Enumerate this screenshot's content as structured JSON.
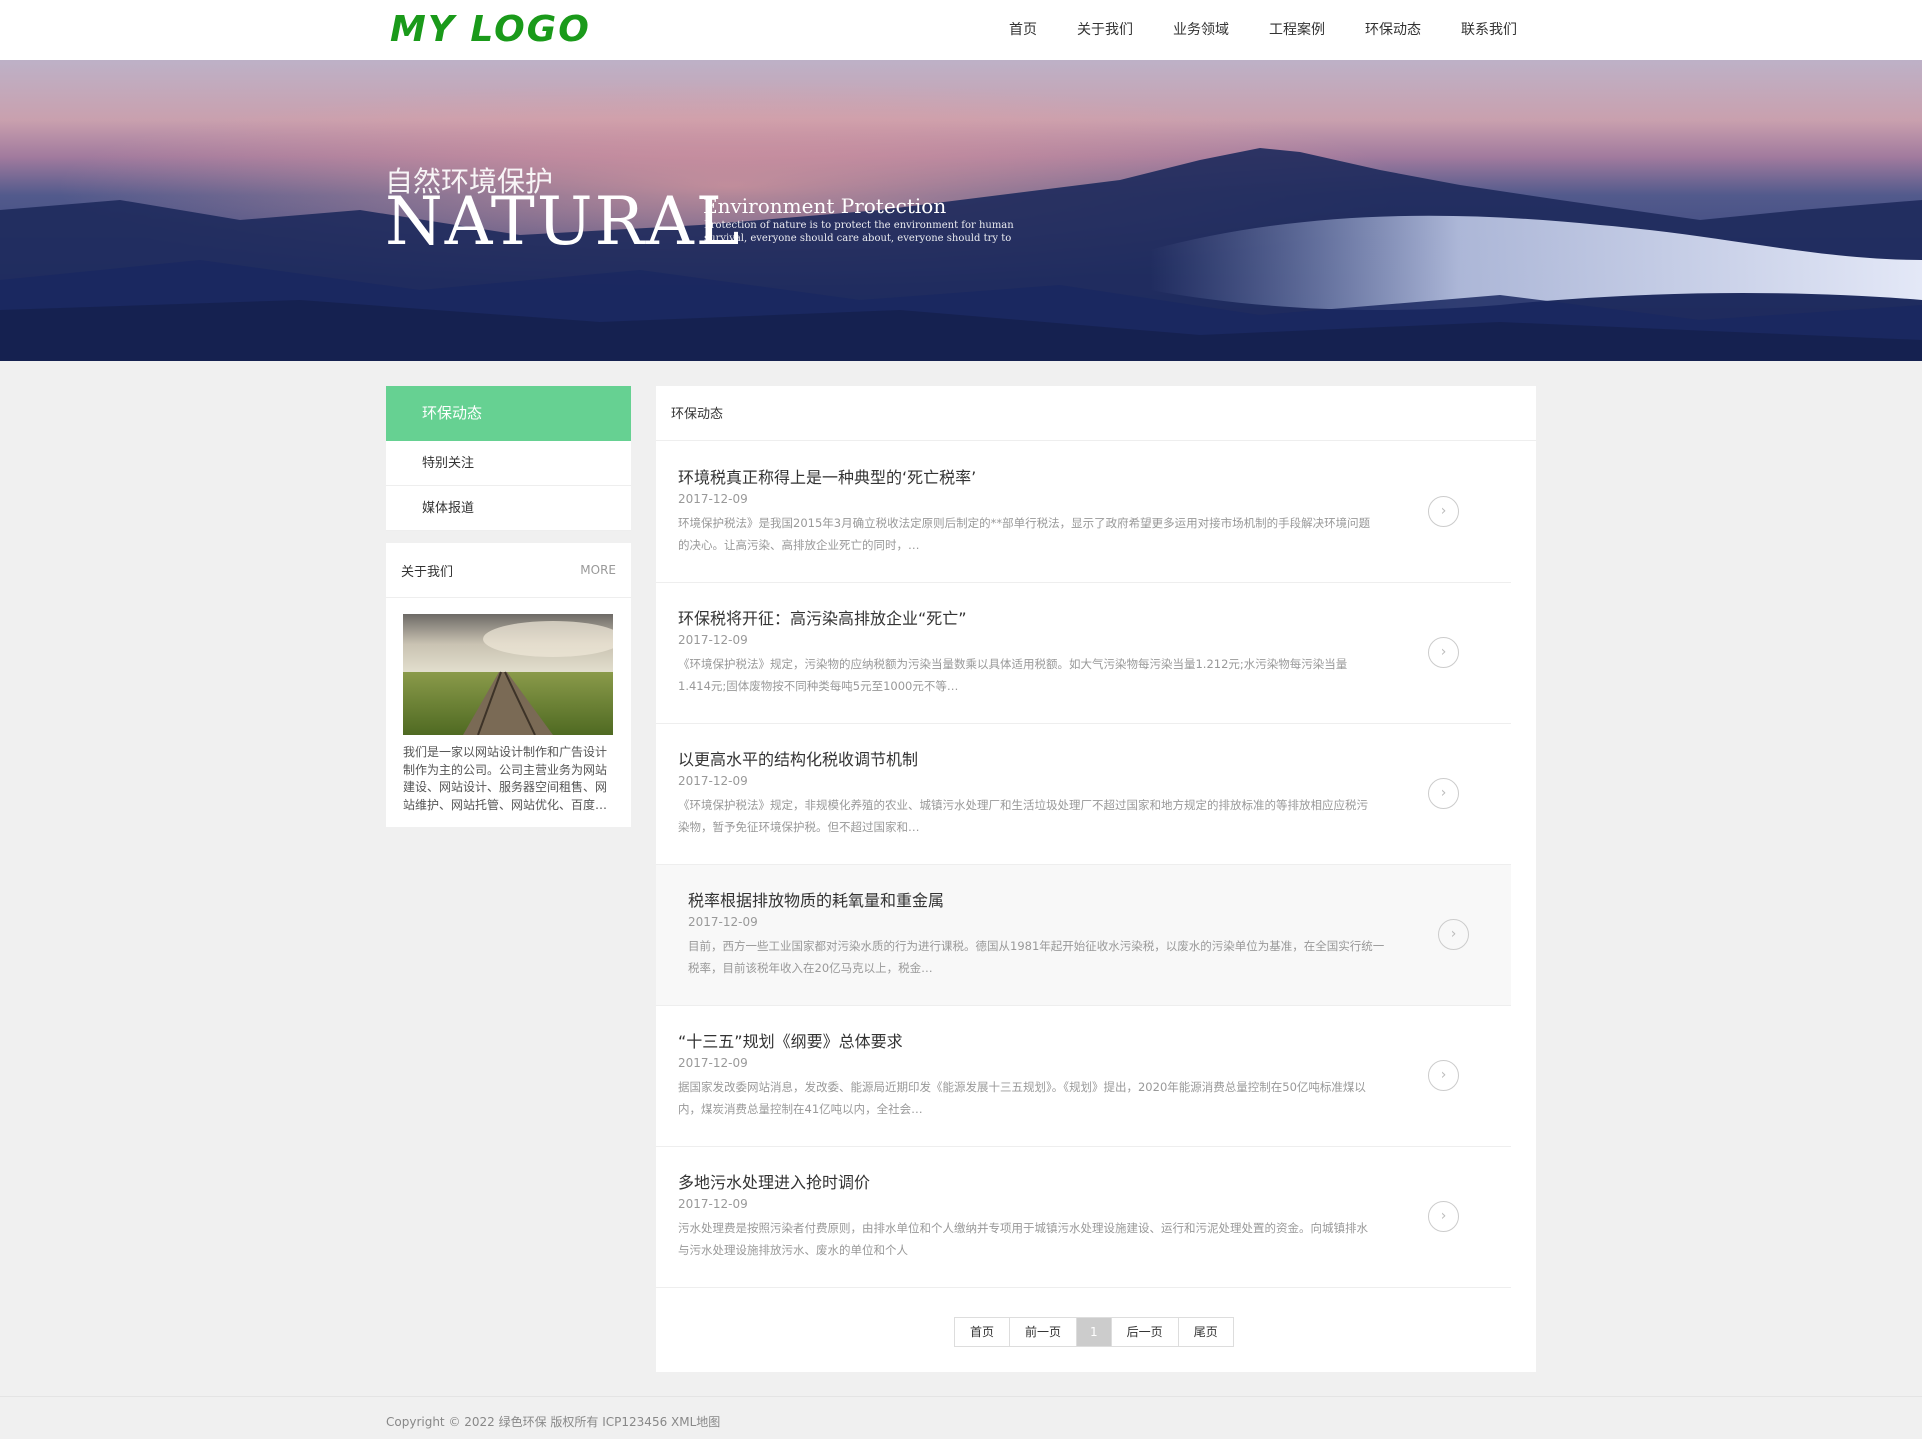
{
  "header": {
    "logo": "MY LOGO",
    "nav": [
      "首页",
      "关于我们",
      "业务领域",
      "工程案例",
      "环保动态",
      "联系我们"
    ]
  },
  "banner": {
    "cn_title": "自然环境保护",
    "big_title": "NATURAL",
    "sub_title": "Environment Protection",
    "desc": "Protection of nature is to protect the environment for human survival, everyone should care about, everyone should try to"
  },
  "sidebar": {
    "active": "环保动态",
    "items": [
      "特别关注",
      "媒体报道"
    ]
  },
  "about": {
    "title": "关于我们",
    "more": "MORE",
    "text": "我们是一家以网站设计制作和广告设计制作为主的公司。公司主营业务为网站建设、网站设计、服务器空间租售、网站维护、网站托管、网站优化、百度…"
  },
  "main": {
    "heading": "环保动态",
    "news": [
      {
        "title": "环境税真正称得上是一种典型的‘死亡税率’",
        "date": "2017-12-09",
        "summary": "环境保护税法》是我国2015年3月确立税收法定原则后制定的**部单行税法，显示了政府希望更多运用对接市场机制的手段解决环境问题的决心。让高污染、高排放企业死亡的同时，…"
      },
      {
        "title": "环保税将开征：高污染高排放企业“死亡”",
        "date": "2017-12-09",
        "summary": "《环境保护税法》规定，污染物的应纳税额为污染当量数乘以具体适用税额。如大气污染物每污染当量1.212元;水污染物每污染当量1.414元;固体废物按不同种类每吨5元至1000元不等…"
      },
      {
        "title": "以更高水平的结构化税收调节机制",
        "date": "2017-12-09",
        "summary": "《环境保护税法》规定，非规模化养殖的农业、城镇污水处理厂和生活垃圾处理厂不超过国家和地方规定的排放标准的等排放相应应税污染物，暂予免征环境保护税。但不超过国家和…"
      },
      {
        "title": "税率根据排放物质的耗氧量和重金属",
        "date": "2017-12-09",
        "summary": "目前，西方一些工业国家都对污染水质的行为进行课税。德国从1981年起开始征收水污染税，以废水的污染单位为基准，在全国实行统一税率，目前该税年收入在20亿马克以上，税金…"
      },
      {
        "title": "“十三五”规划《纲要》总体要求",
        "date": "2017-12-09",
        "summary": "据国家发改委网站消息，发改委、能源局近期印发《能源发展十三五规划》。《规划》提出，2020年能源消费总量控制在50亿吨标准煤以内，煤炭消费总量控制在41亿吨以内，全社会…"
      },
      {
        "title": "多地污水处理进入抢时调价",
        "date": "2017-12-09",
        "summary": "污水处理费是按照污染者付费原则，由排水单位和个人缴纳并专项用于城镇污水处理设施建设、运行和污泥处理处置的资金。向城镇排水与污水处理设施排放污水、废水的单位和个人"
      }
    ],
    "arrow_glyph": "›"
  },
  "pager": [
    "首页",
    "前一页",
    "1",
    "后一页",
    "尾页"
  ],
  "footer": {
    "copyright": "Copyright © 2022 绿色环保 版权所有  ICP123456 XML地图"
  },
  "colors": {
    "logo": "#1a9a1a",
    "accent": "#66d192"
  }
}
